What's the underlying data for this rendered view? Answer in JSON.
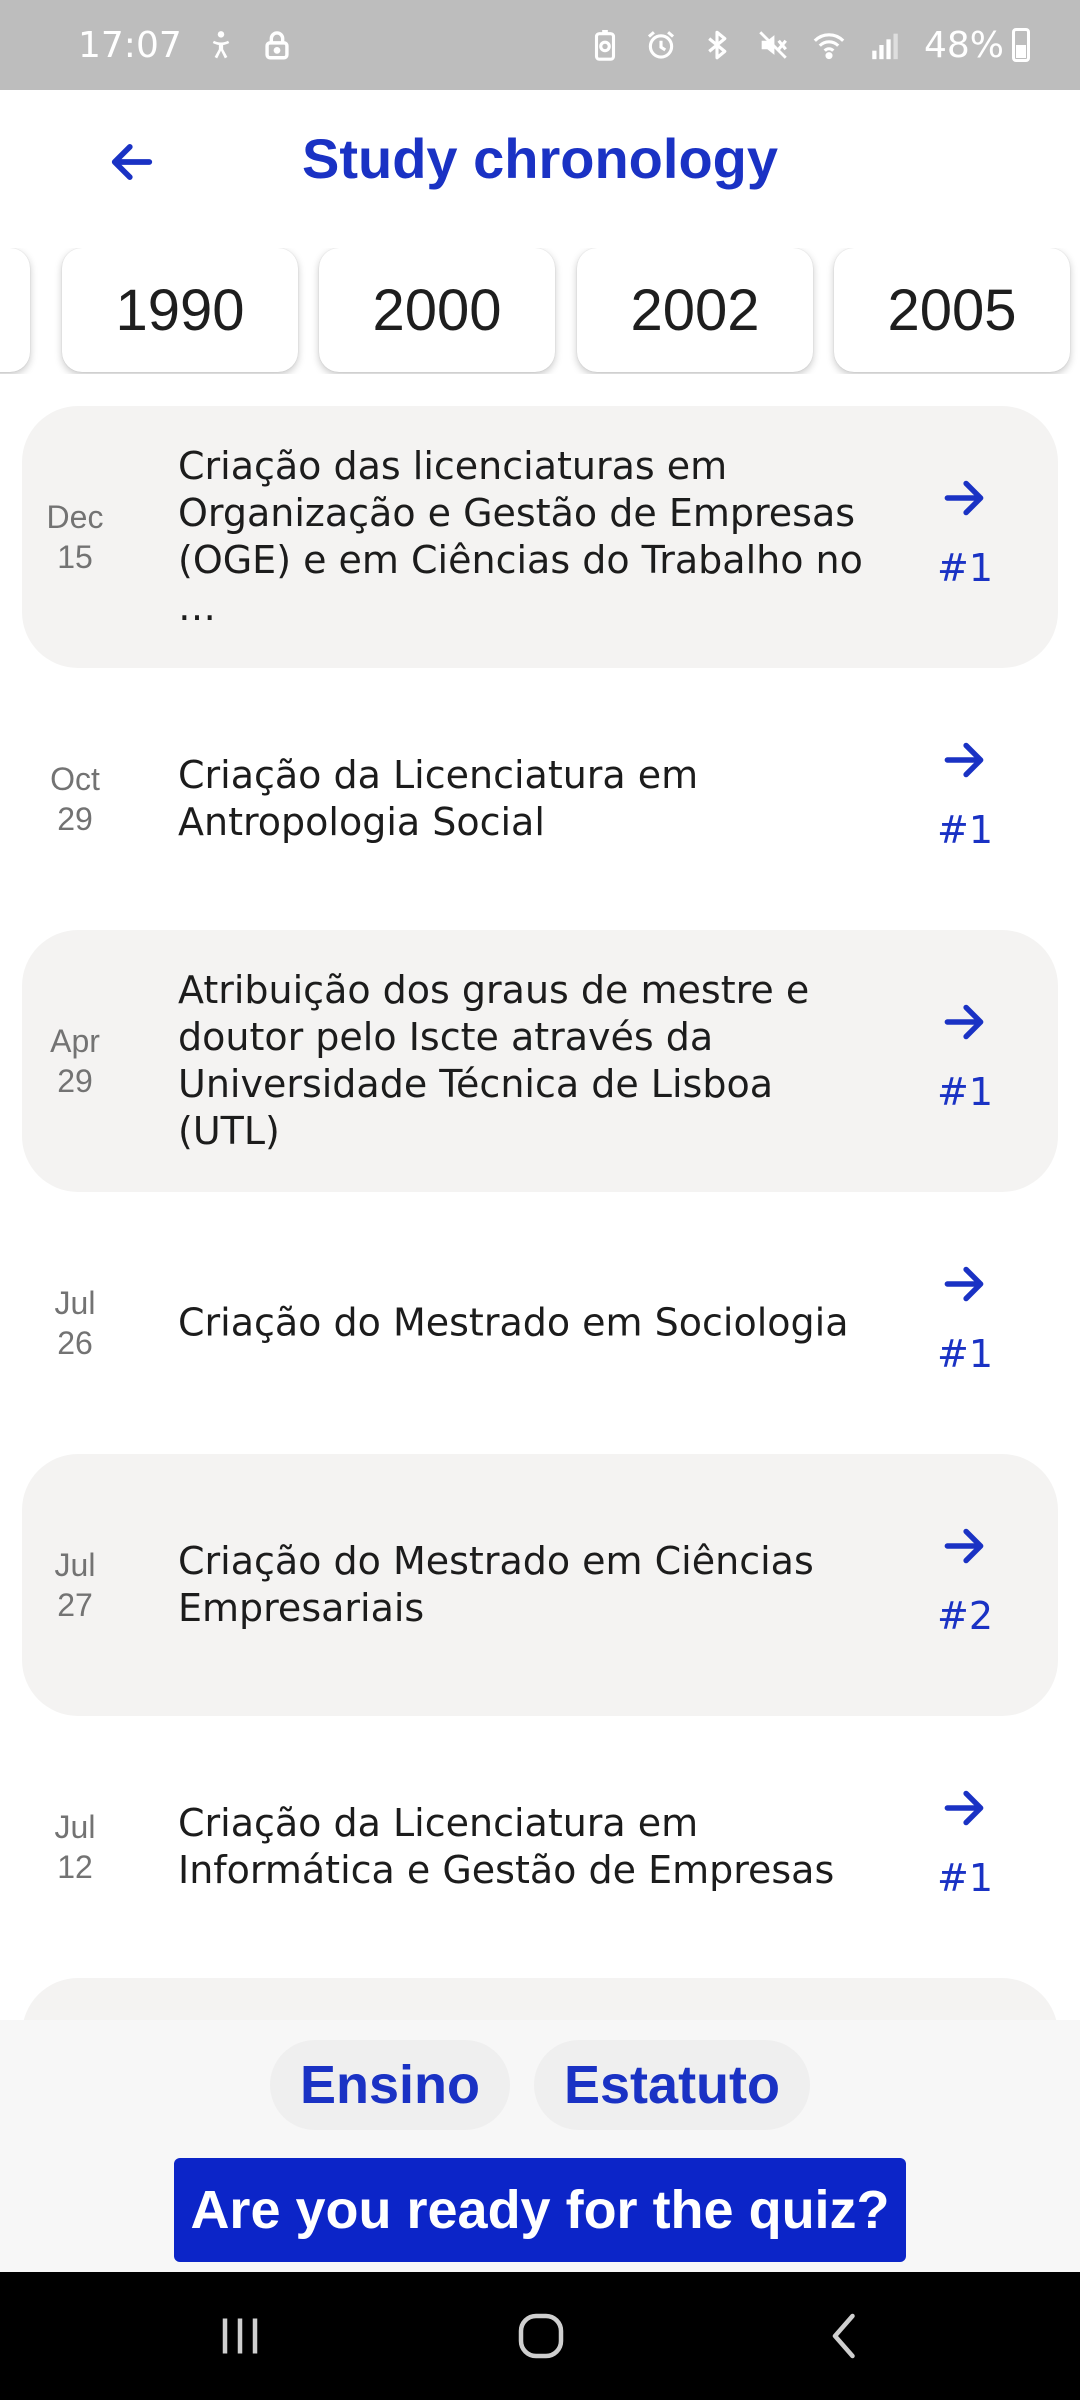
{
  "status_bar": {
    "time": "17:07",
    "battery": "48%",
    "left_icons": [
      "accessibility-icon",
      "lock-icon"
    ],
    "right_icons": [
      "battery-saver-icon",
      "alarm-icon",
      "bluetooth-icon",
      "mute-icon",
      "wifi-icon",
      "signal-icon"
    ]
  },
  "header": {
    "title": "Study chronology",
    "back_icon": "arrow-left-icon"
  },
  "years": [
    "1990",
    "2000",
    "2002",
    "2005"
  ],
  "events": [
    {
      "month": "Dec",
      "day": "15",
      "text": "Criação das licenciaturas em Organização e Gestão de Empresas (OGE) e em Ciências do Trabalho no …",
      "badge": "#1",
      "shaded": true
    },
    {
      "month": "Oct",
      "day": "29",
      "text": "Criação da Licenciatura em Antropologia Social",
      "badge": "#1",
      "shaded": false
    },
    {
      "month": "Apr",
      "day": "29",
      "text": "Atribuição dos graus de mestre e doutor pelo Iscte através da Universidade Técnica de Lisboa (UTL)",
      "badge": "#1",
      "shaded": true
    },
    {
      "month": "Jul",
      "day": "26",
      "text": "Criação do Mestrado em Sociologia",
      "badge": "#1",
      "shaded": false
    },
    {
      "month": "Jul",
      "day": "27",
      "text": "Criação do Mestrado em Ciências Empresariais",
      "badge": "#2",
      "shaded": true
    },
    {
      "month": "Jul",
      "day": "12",
      "text": "Criação da Licenciatura em Informática e Gestão de Empresas",
      "badge": "#1",
      "shaded": false
    }
  ],
  "filters": [
    "Ensino",
    "Estatuto"
  ],
  "quiz_button": "Are you ready for the quiz?",
  "colors": {
    "accent": "#1a32c4",
    "quiz_button_bg": "#0c25c8",
    "card_shaded_bg": "#f4f3f2",
    "status_bar_bg": "#bdbdbd"
  },
  "nav_bar": {
    "icons": [
      "recent-apps-icon",
      "home-icon",
      "back-icon"
    ]
  }
}
